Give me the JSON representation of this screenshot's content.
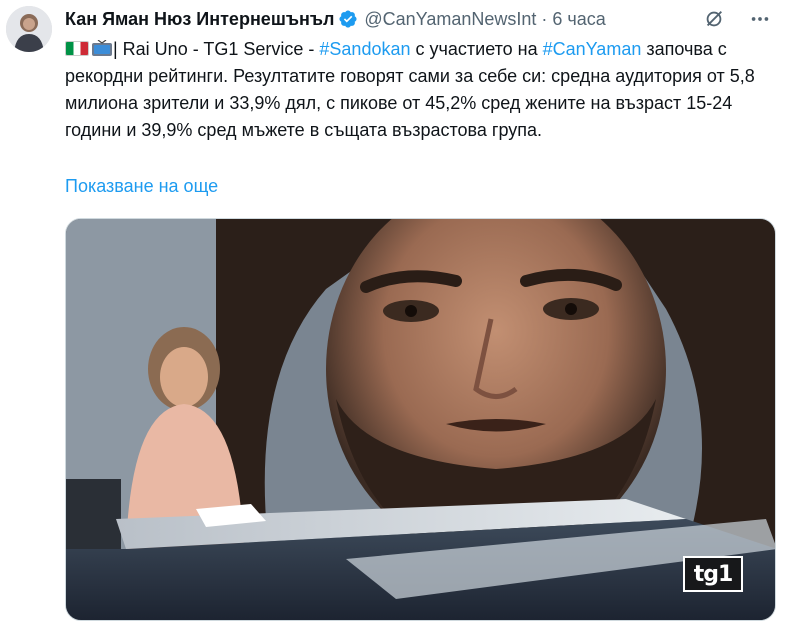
{
  "author": {
    "display_name": "Кан Яман Нюз Интернешънъл",
    "handle": "@CanYamanNewsInt",
    "separator": "·",
    "time": "6 часа",
    "verified_icon": "verified-badge-icon",
    "avatar_icon": "avatar"
  },
  "header_icons": [
    "grok-icon",
    "more-icon"
  ],
  "tweet": {
    "text_part1": "| Rai Uno - TG1 Service - ",
    "hashtag1": "#Sandokan",
    "text_part2": " с участието на  ",
    "hashtag2": "#CanYaman",
    "text_part3": " започва с рекордни рейтинги. Резултатите говорят сами за себе си: средна аудитория от 5,8 милиона зрители и 33,9% дял, с пикове от 45,2% сред жените на възраст 15-24 години и 39,9% сред мъжете в същата възрастова група.",
    "emoji": [
      "italy-flag-icon",
      "tv-icon"
    ]
  },
  "show_more": "Показване на още",
  "media": {
    "logo_text": "tg1"
  },
  "colors": {
    "accent": "#1d9bf0",
    "text": "#0f1419",
    "secondary": "#536471"
  }
}
